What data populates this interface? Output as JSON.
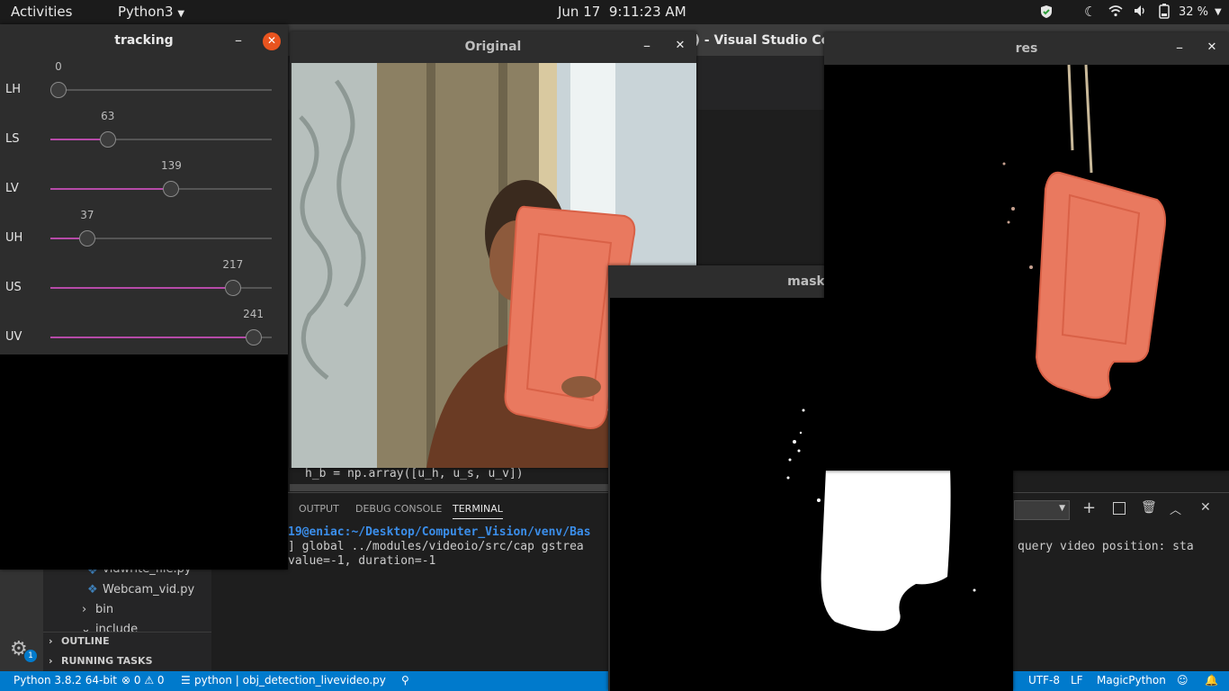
{
  "topbar": {
    "activities": "Activities",
    "app_menu": "Python3",
    "date": "Jun 17",
    "time": "9:11:23 AM",
    "battery": "32 %"
  },
  "vscode": {
    "title_fragment": "e) - Visual Studio Co",
    "breadcrumb": "> ...",
    "code_line": "h_b = np.array([u_h, u_s, u_v])",
    "panel_tabs": [
      "OUTPUT",
      "DEBUG CONSOLE",
      "TERMINAL"
    ],
    "terminal": {
      "prompt": "19@eniac:~/Desktop/Computer_Vision/venv/Bas",
      "line1": "] global ../modules/videoio/src/cap gstrea",
      "line2": "value=-1, duration=-1",
      "line1_right": "query video position: sta"
    },
    "explorer": {
      "file1": "vidwrite_file.py",
      "file2": "Webcam_vid.py",
      "folder1": "bin",
      "folder2": "include",
      "outline": "OUTLINE",
      "running_tasks": "RUNNING TASKS"
    },
    "gear_badge": "1",
    "statusbar": {
      "python": "Python 3.8.2 64-bit",
      "problems": "⊗ 0 ⚠ 0",
      "file": "python | obj_detection_livevideo.py",
      "encoding": "UTF-8",
      "eol": "LF",
      "language": "MagicPython"
    }
  },
  "windows": {
    "tracking": {
      "title": "tracking",
      "sliders": [
        {
          "label": "LH",
          "value": "0",
          "fraction": 0.0
        },
        {
          "label": "LS",
          "value": "63",
          "fraction": 0.24
        },
        {
          "label": "LV",
          "value": "139",
          "fraction": 0.55
        },
        {
          "label": "UH",
          "value": "37",
          "fraction": 0.14
        },
        {
          "label": "US",
          "value": "217",
          "fraction": 0.85
        },
        {
          "label": "UV",
          "value": "241",
          "fraction": 0.95
        }
      ]
    },
    "original": {
      "title": "Original"
    },
    "mask": {
      "title": "mask"
    },
    "res": {
      "title": "res"
    }
  },
  "colors": {
    "vscode_blue": "#007acc",
    "slider_fill": "#b64aa8",
    "close_orange": "#e9541f",
    "object_orange": "#e9795f"
  }
}
